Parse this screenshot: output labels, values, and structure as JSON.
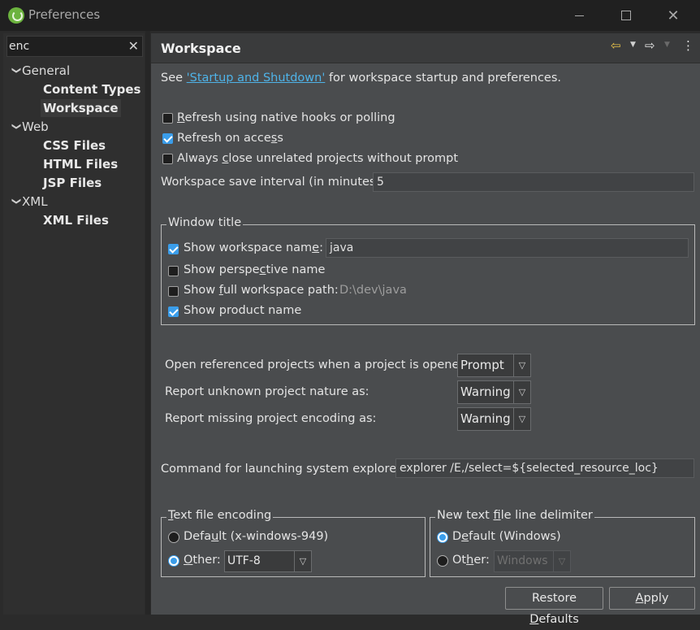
{
  "window": {
    "title": "Preferences"
  },
  "filter": {
    "value": "enc"
  },
  "tree": [
    {
      "label": "General",
      "level": 0
    },
    {
      "label": "Content Types",
      "level": 1
    },
    {
      "label": "Workspace",
      "level": 1,
      "selected": true
    },
    {
      "label": "Web",
      "level": 0
    },
    {
      "label": "CSS Files",
      "level": 1
    },
    {
      "label": "HTML Files",
      "level": 1
    },
    {
      "label": "JSP Files",
      "level": 1
    },
    {
      "label": "XML",
      "level": 0
    },
    {
      "label": "XML Files",
      "level": 1
    }
  ],
  "page": {
    "title": "Workspace",
    "intro_prefix": "See ",
    "intro_link": "'Startup and Shutdown'",
    "intro_suffix": " for workspace startup and preferences.",
    "refresh_native": {
      "pre": "",
      "u": "R",
      "post": "efresh using native hooks or polling",
      "checked": false
    },
    "refresh_access": {
      "pre": "Refresh on acce",
      "u": "s",
      "post": "s",
      "checked": true
    },
    "always_close": {
      "pre": "Always ",
      "u": "c",
      "post": "lose unrelated projects without prompt",
      "checked": false
    },
    "save_interval_label": "Workspace save interval (in minutes):",
    "save_interval_value": "5",
    "window_title": {
      "label": "Window title",
      "show_ws_name": {
        "pre": "Show workspace nam",
        "u": "e",
        "post": ":",
        "checked": true
      },
      "ws_name_value": "java",
      "show_perspective": {
        "pre": "Show perspe",
        "u": "c",
        "post": "tive name",
        "checked": false
      },
      "show_full_path": {
        "pre": "Show ",
        "u": "f",
        "post": "ull workspace path:",
        "checked": false
      },
      "full_path_value": "D:\\dev\\java",
      "show_product": {
        "label": "Show product name",
        "checked": true
      }
    },
    "open_ref_label": "Open referenced projects when a project is opened:",
    "open_ref_value": "Prompt",
    "unknown_nature_label": "Report unknown project nature as:",
    "unknown_nature_value": "Warning",
    "missing_encoding_label": "Report missing project encoding as:",
    "missing_encoding_value": "Warning",
    "explorer_label": "Command for launching system explorer:",
    "explorer_value": "explorer /E,/select=${selected_resource_loc}",
    "encoding": {
      "label_u": "T",
      "label_post": "ext file encoding",
      "default": {
        "pre": "Defa",
        "u": "u",
        "post": "lt (x-windows-949)",
        "checked": false
      },
      "other": {
        "pre": "",
        "u": "O",
        "post": "ther:",
        "checked": true
      },
      "other_value": "UTF-8"
    },
    "delimiter": {
      "label_pre": "New text ",
      "label_u": "f",
      "label_post": "ile line delimiter",
      "default": {
        "pre": "D",
        "u": "e",
        "post": "fault (Windows)",
        "checked": true
      },
      "other": {
        "pre": "Ot",
        "u": "h",
        "post": "er:",
        "checked": false
      },
      "other_value": "Windows"
    },
    "restore_defaults": {
      "pre": "Restore ",
      "u": "D",
      "post": "efaults"
    },
    "apply": {
      "pre": "",
      "u": "A",
      "post": "pply"
    }
  },
  "colors": {
    "accent": "#3a9dea",
    "link": "#4fb3e8",
    "nav_arrow": "#e8c24a"
  }
}
